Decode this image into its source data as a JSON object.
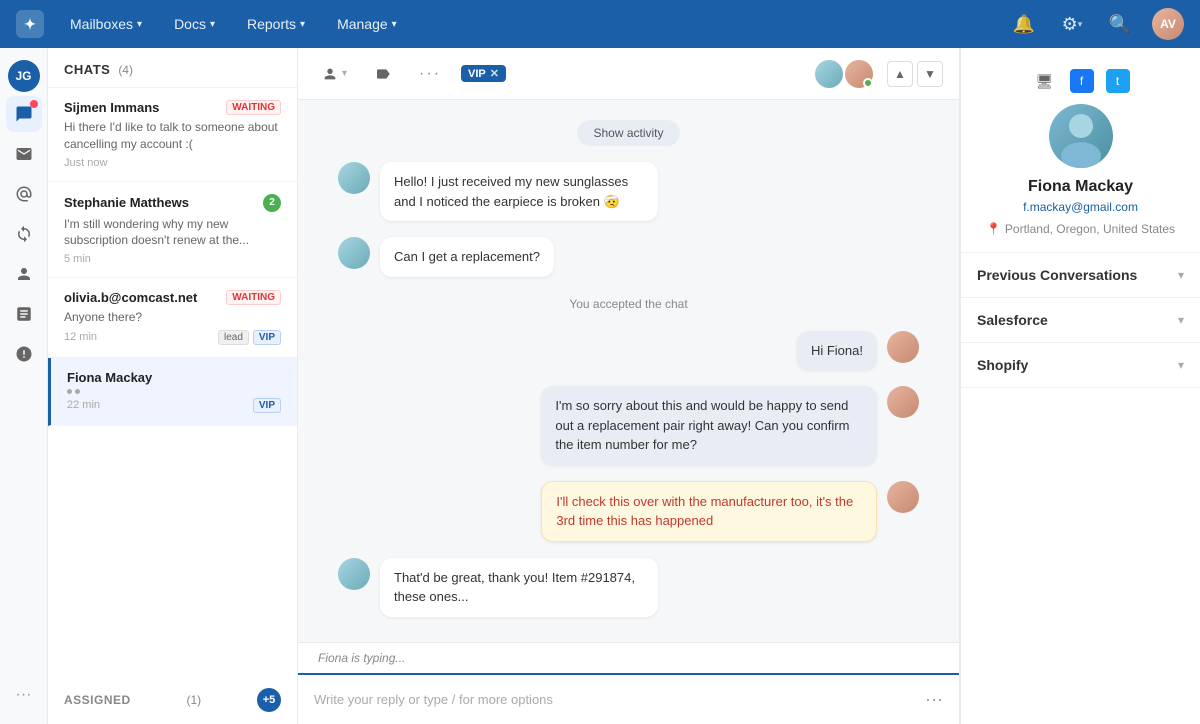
{
  "nav": {
    "logo": "✦",
    "items": [
      {
        "label": "Mailboxes",
        "id": "mailboxes"
      },
      {
        "label": "Docs",
        "id": "docs"
      },
      {
        "label": "Reports",
        "id": "reports"
      },
      {
        "label": "Manage",
        "id": "manage"
      }
    ],
    "user_initials": "AV"
  },
  "icon_sidebar": {
    "items": [
      {
        "icon": "JG",
        "type": "avatar",
        "id": "user-avatar"
      },
      {
        "icon": "💬",
        "id": "chats",
        "active": true,
        "has_dot": true
      },
      {
        "icon": "✉",
        "id": "inbox"
      },
      {
        "icon": "↩",
        "id": "mentions"
      },
      {
        "icon": "🔄",
        "id": "refresh"
      },
      {
        "icon": "👥",
        "id": "contacts"
      },
      {
        "icon": "📋",
        "id": "reports-icon"
      },
      {
        "icon": "⊘",
        "id": "blocked"
      }
    ],
    "more": "···"
  },
  "chat_list": {
    "title": "CHATS",
    "count": "(4)",
    "items": [
      {
        "id": "sijmen",
        "name": "Sijmen Immans",
        "badge": "WAITING",
        "preview": "Hi there I'd like to talk to someone about cancelling my account :(",
        "time": "Just now",
        "tags": []
      },
      {
        "id": "stephanie",
        "name": "Stephanie Matthews",
        "badge_unread": "2",
        "preview": "I'm still wondering why my new subscription doesn't renew at the...",
        "time": "5 min",
        "tags": []
      },
      {
        "id": "olivia",
        "name": "olivia.b@comcast.net",
        "badge": "WAITING",
        "preview": "Anyone there?",
        "time": "12 min",
        "tags": [
          "lead",
          "VIP"
        ]
      },
      {
        "id": "fiona",
        "name": "Fiona Mackay",
        "active": true,
        "preview_typing": true,
        "time": "22 min",
        "tags": [
          "VIP"
        ]
      }
    ],
    "assigned": {
      "label": "ASSIGNED",
      "count": "(1)",
      "btn": "+5"
    }
  },
  "chat_main": {
    "vip_badge": "VIP",
    "show_activity": "Show activity",
    "messages": [
      {
        "id": "msg1",
        "type": "incoming",
        "text": "Hello! I just received my new sunglasses and I noticed the earpiece is broken 🤕",
        "sender": "customer"
      },
      {
        "id": "msg2",
        "type": "incoming",
        "text": "Can I get a replacement?",
        "sender": "customer"
      },
      {
        "id": "accepted",
        "type": "system",
        "text": "You accepted the chat"
      },
      {
        "id": "msg3",
        "type": "outgoing",
        "text": "Hi Fiona!",
        "sender": "agent"
      },
      {
        "id": "msg4",
        "type": "outgoing",
        "text": "I'm so sorry about this and would be happy to send out a replacement pair right away! Can you confirm the item number for me?",
        "sender": "agent"
      },
      {
        "id": "msg5",
        "type": "outgoing_highlight",
        "text": "I'll check this over with the manufacturer too, it's the 3rd time this has happened",
        "sender": "agent"
      },
      {
        "id": "msg6",
        "type": "incoming",
        "text": "That'd be great, thank you! Item #291874, these ones...",
        "sender": "customer"
      }
    ],
    "typing_text": "Fiona is typing...",
    "reply_placeholder": "Write your reply or type / for more options"
  },
  "right_panel": {
    "contact": {
      "name": "Fiona Mackay",
      "email": "f.mackay@gmail.com",
      "location": "Portland, Oregon, United States"
    },
    "sections": [
      {
        "id": "previous-conversations",
        "title": "Previous Conversations"
      },
      {
        "id": "salesforce",
        "title": "Salesforce"
      },
      {
        "id": "shopify",
        "title": "Shopify"
      }
    ]
  }
}
